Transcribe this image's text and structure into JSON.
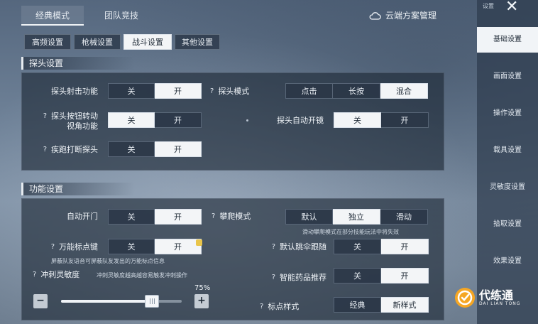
{
  "mode_tabs": [
    {
      "label": "经典模式",
      "active": true
    },
    {
      "label": "团队竞技",
      "active": false
    }
  ],
  "cloud": {
    "label": "云端方案管理",
    "icon": "cloud-icon"
  },
  "sub_tabs": [
    {
      "label": "高频设置",
      "active": false
    },
    {
      "label": "枪械设置",
      "active": false
    },
    {
      "label": "战斗设置",
      "active": true
    },
    {
      "label": "其他设置",
      "active": false
    }
  ],
  "peek": {
    "title": "探头设置",
    "shoot": {
      "label": "探头射击功能",
      "options": [
        "关",
        "开"
      ],
      "selected": "开"
    },
    "mode": {
      "label": "探头模式",
      "options": [
        "点击",
        "长按",
        "混合"
      ],
      "selected": "混合"
    },
    "turn": {
      "label_line1": "探头按钮转动",
      "label_line2": "视角功能",
      "options": [
        "关",
        "开"
      ],
      "selected": "关"
    },
    "auto_scope": {
      "label": "探头自动开镜",
      "options": [
        "关",
        "开"
      ],
      "selected": "关"
    },
    "sprint": {
      "label": "疾跑打断探头",
      "options": [
        "关",
        "开"
      ],
      "selected": "开"
    }
  },
  "func": {
    "title": "功能设置",
    "auto_door": {
      "label": "自动开门",
      "options": [
        "关",
        "开"
      ],
      "selected": "开"
    },
    "climb": {
      "label": "攀爬模式",
      "options": [
        "默认",
        "独立",
        "滑动"
      ],
      "selected": "独立",
      "hint": "滑动攀爬模式在部分技能玩法中将失效"
    },
    "marker": {
      "label": "万能标点键",
      "options": [
        "关",
        "开"
      ],
      "selected": "开",
      "hint": "屏蔽队友语音可屏蔽队友发出的万能标点信息"
    },
    "parachute": {
      "label": "默认跳伞跟随",
      "options": [
        "关",
        "开"
      ],
      "selected": "开"
    },
    "sprint_sens": {
      "label": "冲刺灵敏度",
      "hint": "冲刺灵敏度越高越容易触发冲刺操作",
      "value": 75,
      "value_text": "75%",
      "minus": "−",
      "plus": "+"
    },
    "med": {
      "label": "智能药品推荐",
      "options": [
        "关",
        "开"
      ],
      "selected": "开"
    },
    "mark_style": {
      "label": "标点样式",
      "options": [
        "经典",
        "新样式"
      ],
      "selected": "新样式"
    }
  },
  "sidebar": {
    "top_label": "设置",
    "close": "✕",
    "items": [
      {
        "label": "基础设置",
        "active": true
      },
      {
        "label": "画面设置",
        "active": false
      },
      {
        "label": "操作设置",
        "active": false
      },
      {
        "label": "载具设置",
        "active": false
      },
      {
        "label": "灵敏度设置",
        "active": false
      },
      {
        "label": "拾取设置",
        "active": false
      },
      {
        "label": "效果设置",
        "active": false
      }
    ]
  },
  "watermark": {
    "cn": "代练通",
    "en": "DAI LIAN TONG"
  },
  "colors": {
    "selected": "#f3f5f7",
    "panel": "#1c2634",
    "accent_logo": "#f5a623"
  }
}
